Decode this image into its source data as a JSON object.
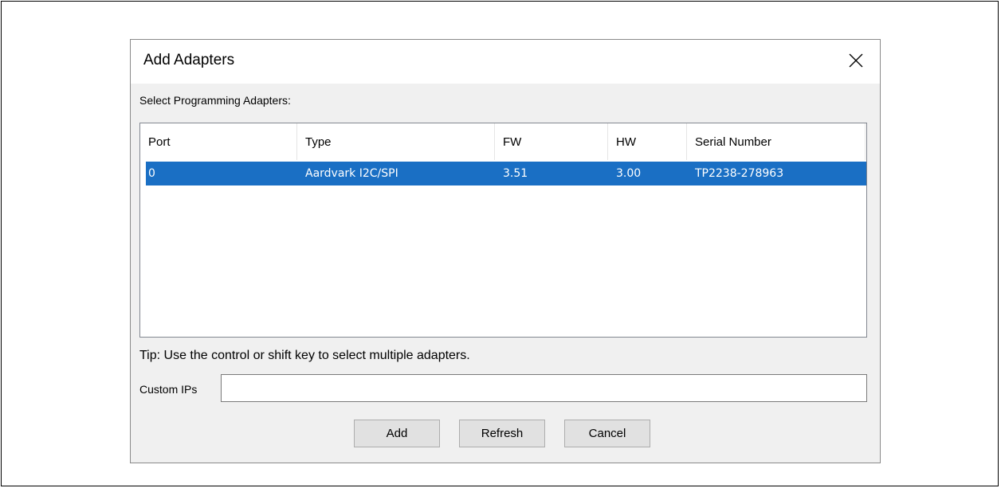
{
  "dialog": {
    "title": "Add Adapters",
    "close_icon": "close-icon"
  },
  "adapters": {
    "section_label": "Select Programming Adapters:",
    "columns": [
      "Port",
      "Type",
      "FW",
      "HW",
      "Serial Number"
    ],
    "rows": [
      {
        "port": "0",
        "type": "Aardvark I2C/SPI",
        "fw": "3.51",
        "hw": "3.00",
        "serial": "TP2238-278963",
        "selected": true
      }
    ],
    "selection_color": "#1a6fc4"
  },
  "tip": "Tip: Use the control or shift key to select multiple adapters.",
  "custom_ips": {
    "label": "Custom IPs",
    "value": "",
    "placeholder": ""
  },
  "buttons": {
    "add": "Add",
    "refresh": "Refresh",
    "cancel": "Cancel"
  }
}
